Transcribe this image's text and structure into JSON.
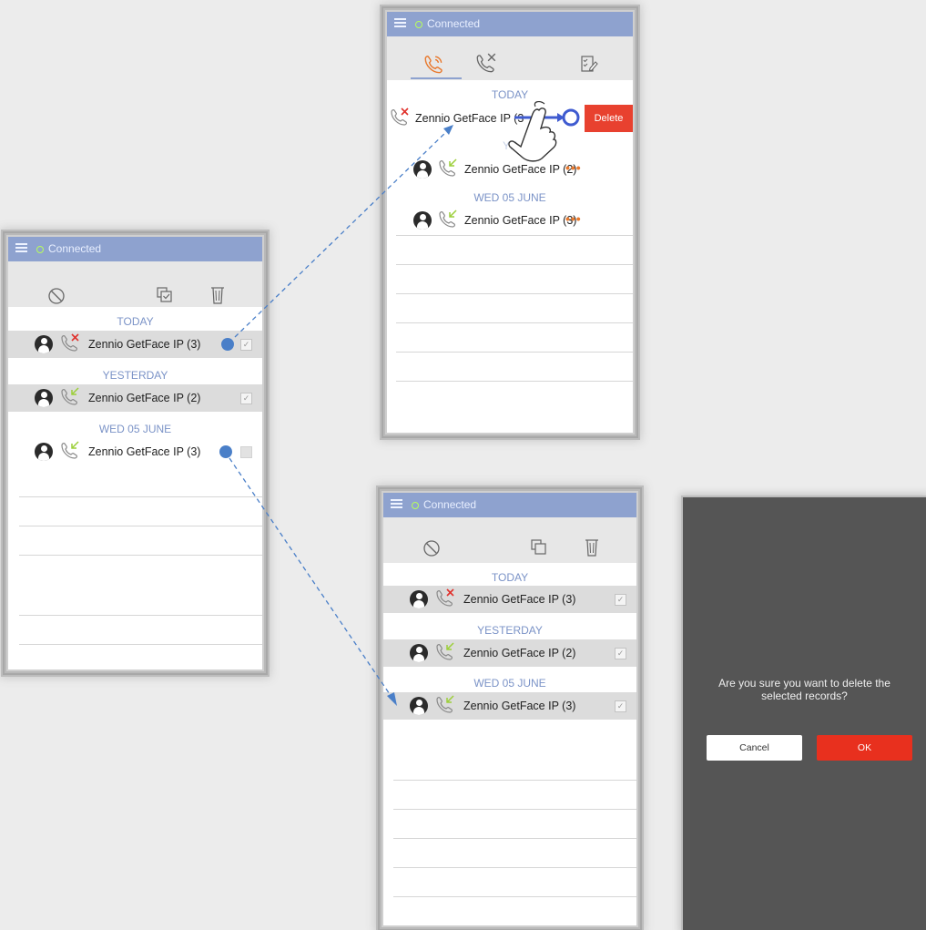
{
  "status": {
    "text": "Connected",
    "dot_color": "#b8ff5a"
  },
  "section_labels": {
    "today": "TODAY",
    "yesterday": "YESTERDAY",
    "wed": "WED 05 JUNE"
  },
  "contacts": {
    "ip3": "Zennio GetFace IP (3)",
    "ip2": "Zennio GetFace IP (2)",
    "ip3_partial": "Zennio GetFace IP (3"
  },
  "swipe_action": {
    "delete_label": "Delete"
  },
  "toolbar_icons": {
    "history": [
      "missed-calls-tab-icon",
      "all-calls-tab-icon",
      "edit-list-icon"
    ],
    "edit": [
      "cancel-selection-icon",
      "select-all-icon",
      "trash-icon"
    ]
  },
  "dialog": {
    "message_line1": "Are you sure you want to delete the",
    "message_line2": "selected records?",
    "cancel_label": "Cancel",
    "ok_label": "OK"
  },
  "colors": {
    "accent": "#8ea2cf",
    "section": "#7b93c7",
    "missed": "#e0312c",
    "incoming": "#9ccf3a",
    "delete": "#e8412f",
    "dots": "#e8782c"
  }
}
